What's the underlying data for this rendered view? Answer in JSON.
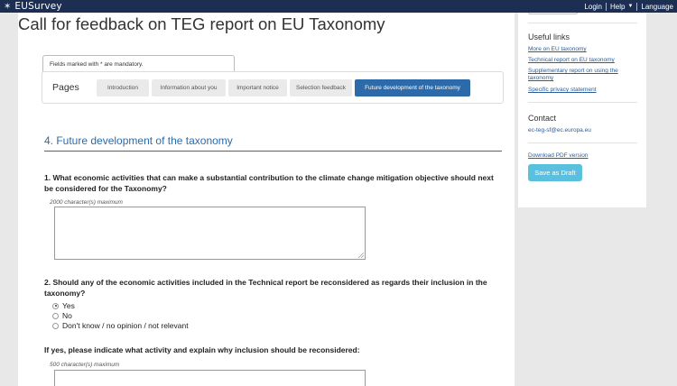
{
  "topbar": {
    "brand": "EUSurvey",
    "nav": {
      "login": "Login",
      "help": "Help",
      "language": "Language"
    }
  },
  "survey": {
    "title": "Call for feedback on TEG report on EU Taxonomy",
    "mandatory_note": "Fields marked with * are mandatory.",
    "pages_label": "Pages",
    "tabs": [
      {
        "label": "Introduction",
        "active": false
      },
      {
        "label": "Information about you",
        "active": false
      },
      {
        "label": "Important notice",
        "active": false
      },
      {
        "label": "Selection feedback",
        "active": false
      },
      {
        "label": "Future development of the taxonomy",
        "active": true
      }
    ],
    "section_heading": "4. Future development of the taxonomy",
    "q1": {
      "text": "1. What economic activities that can make a substantial contribution to the climate change mitigation objective should next be considered for the Taxonomy?",
      "hint": "2000 character(s) maximum",
      "value": ""
    },
    "q2": {
      "text": "2. Should any of the economic activities included in the Technical report be reconsidered as regards their inclusion in the taxonomy?",
      "options": [
        {
          "label": "Yes",
          "checked": true
        },
        {
          "label": "No",
          "checked": false
        },
        {
          "label": "Don't know / no opinion / not relevant",
          "checked": false
        }
      ]
    },
    "q3": {
      "text": "If yes, please indicate what activity and explain why inclusion should be reconsidered:",
      "hint": "500 character(s) maximum",
      "value": ""
    }
  },
  "sidebar": {
    "useful_links_heading": "Useful links",
    "links": [
      "More on EU taxonomy",
      "Technical report on EU taxonomy",
      "Supplementary report on using the taxonomy",
      "Specific privacy statement"
    ],
    "contact_heading": "Contact",
    "contact_email": "ec-teg-sf@ec.europa.eu",
    "download_pdf": "Download PDF version",
    "save_draft": "Save as Draft"
  },
  "colors": {
    "topbar": "#1c2f52",
    "accent": "#2d6aa9",
    "draft_button": "#5bc0de",
    "link": "#2a5d9a"
  }
}
